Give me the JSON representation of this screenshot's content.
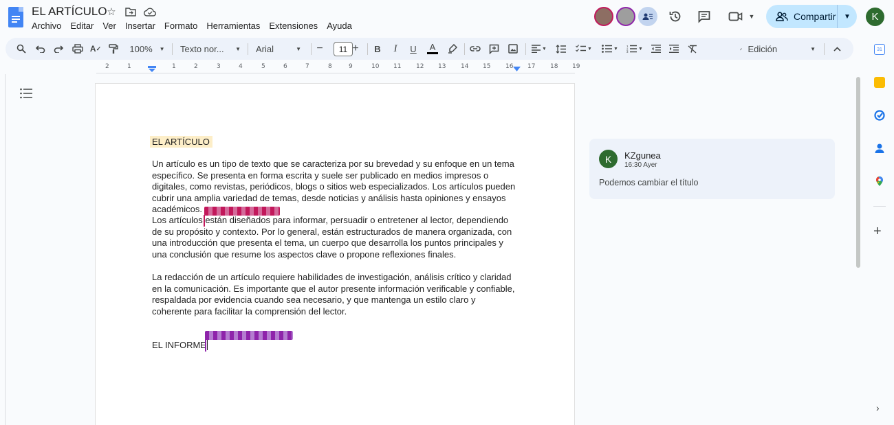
{
  "title_bar": {
    "doc_title": "EL ARTÍCULO",
    "icons": [
      "star-icon",
      "move-folder-icon",
      "cloud-saved-icon"
    ]
  },
  "menu": [
    "Archivo",
    "Editar",
    "Ver",
    "Insertar",
    "Formato",
    "Herramientas",
    "Extensiones",
    "Ayuda"
  ],
  "header_right": {
    "share_label": "Compartir",
    "user_initial": "K",
    "icons": [
      "history-icon",
      "comments-icon",
      "meet-video-icon",
      "caret-down-icon"
    ]
  },
  "toolbar": {
    "zoom": "100%",
    "style": "Texto nor...",
    "font": "Arial",
    "font_size": "11",
    "mode": "Edición"
  },
  "ruler": {
    "ticks": [
      "2",
      "1",
      "1",
      "2",
      "3",
      "4",
      "5",
      "6",
      "7",
      "8",
      "9",
      "10",
      "11",
      "12",
      "13",
      "14",
      "15",
      "16",
      "17",
      "18",
      "19"
    ]
  },
  "document": {
    "heading": "EL ARTÍCULO",
    "paragraphs": [
      "Un artículo es un tipo de texto que se caracteriza por su brevedad y su enfoque en un tema específico. Se presenta en forma escrita y suele ser publicado en medios impresos o digitales, como revistas, periódicos, blogs o sitios web especializados. Los artículos pueden cubrir una amplia variedad de temas, desde noticias y análisis hasta opiniones y ensayos académicos.",
      "Los artículos están diseñados para informar, persuadir o entretener al lector, dependiendo de su propósito y contexto. Por lo general, están estructurados de manera organizada, con una introducción que presenta el tema, un cuerpo que desarrolla los puntos principales y una conclusión que resume los aspectos clave o propone reflexiones finales.",
      "La redacción de un artículo requiere habilidades de investigación, análisis crítico y claridad en la comunicación. Es importante que el autor presente información verificable y confiable, respaldada por evidencia cuando sea necesario, y que mantenga un estilo claro y coherente para facilitar la comprensión del lector."
    ],
    "heading2": "EL INFORME"
  },
  "comment": {
    "initial": "K",
    "author": "KZgunea",
    "time": "16:30 Ayer",
    "text": "Podemos cambiar el título"
  },
  "colors": {
    "accent": "#c2e7ff",
    "toolbar_bg": "#edf2fa",
    "heading_highlight": "#fdeec8",
    "collaborator_1": "#c2185b",
    "collaborator_2": "#8e24aa",
    "user_avatar": "#2e6b2f"
  }
}
